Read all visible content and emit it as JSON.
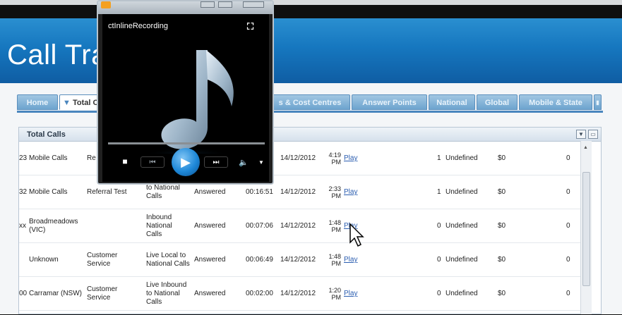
{
  "app": {
    "title": "Call Tra"
  },
  "tabs": [
    {
      "label": "Home"
    },
    {
      "label": "Total C"
    },
    {
      "label": "s & Cost Centres"
    },
    {
      "label": "Answer Points"
    },
    {
      "label": "National"
    },
    {
      "label": "Global"
    },
    {
      "label": "Mobile & State"
    }
  ],
  "panel": {
    "title": "Total Calls",
    "rows": [
      {
        "id": "23",
        "name": "Mobile Calls",
        "group": "Re",
        "type": "",
        "status": "",
        "duration": "",
        "date": "14/12/2012",
        "time_hm": "4:19",
        "time_ampm": "PM",
        "play": "Play",
        "count": "1",
        "result": "Undefined",
        "cost": "$0",
        "zero": "0"
      },
      {
        "id": "32",
        "name": "Mobile Calls",
        "group": "Referral Test",
        "type": "to National Calls",
        "status": "Answered",
        "duration": "00:16:51",
        "date": "14/12/2012",
        "time_hm": "2:33",
        "time_ampm": "PM",
        "play": "Play",
        "count": "1",
        "result": "Undefined",
        "cost": "$0",
        "zero": "0"
      },
      {
        "id": "xx",
        "name": "Broadmeadows (VIC)",
        "group": "",
        "type": "Inbound National Calls",
        "status": "Answered",
        "duration": "00:07:06",
        "date": "14/12/2012",
        "time_hm": "1:48",
        "time_ampm": "PM",
        "play": "Play",
        "count": "0",
        "result": "Undefined",
        "cost": "$0",
        "zero": "0"
      },
      {
        "id": "",
        "name": "Unknown",
        "group": "Customer Service",
        "type": "Live Local to National Calls",
        "status": "Answered",
        "duration": "00:06:49",
        "date": "14/12/2012",
        "time_hm": "1:48",
        "time_ampm": "PM",
        "play": "Play",
        "count": "0",
        "result": "Undefined",
        "cost": "$0",
        "zero": "0"
      },
      {
        "id": "00",
        "name": "Carramar (NSW)",
        "group": "Customer Service",
        "type": "Live Inbound to National Calls",
        "status": "Answered",
        "duration": "00:02:00",
        "date": "14/12/2012",
        "time_hm": "1:20",
        "time_ampm": "PM",
        "play": "Play",
        "count": "0",
        "result": "Undefined",
        "cost": "$0",
        "zero": "0"
      }
    ]
  },
  "player": {
    "title": "ctInlineRecording",
    "icons": [
      "switch-view-icon",
      "stop-icon",
      "previous-icon",
      "play-icon",
      "next-icon",
      "volume-icon",
      "volume-dropdown-icon"
    ],
    "accent_color": "#1e88d8"
  },
  "colors": {
    "header_blue": "#1677bf",
    "tab_blue": "#6da4cf",
    "link_blue": "#2a5db0"
  }
}
